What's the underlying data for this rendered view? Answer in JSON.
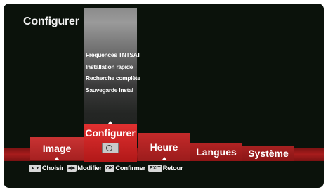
{
  "header": {
    "title": "Configurer"
  },
  "submenu": {
    "items": [
      {
        "label": "Fréquences TNTSAT"
      },
      {
        "label": "Installation rapide"
      },
      {
        "label": "Recherche complète"
      },
      {
        "label": "Sauvegarde Instal"
      }
    ]
  },
  "tabs": [
    {
      "label": "Image"
    },
    {
      "label": "Configurer",
      "selected": true
    },
    {
      "label": "Heure"
    },
    {
      "label": "Langues"
    },
    {
      "label": "Système"
    }
  ],
  "hints": [
    {
      "key": "▲▼",
      "label": "Choisir"
    },
    {
      "key": "◀▶",
      "label": "Modifier"
    },
    {
      "key": "OK",
      "label": "Confirmer"
    },
    {
      "key": "EXIT",
      "label": "Retour"
    }
  ],
  "colors": {
    "accent": "#c62828",
    "background": "#0b120b"
  }
}
